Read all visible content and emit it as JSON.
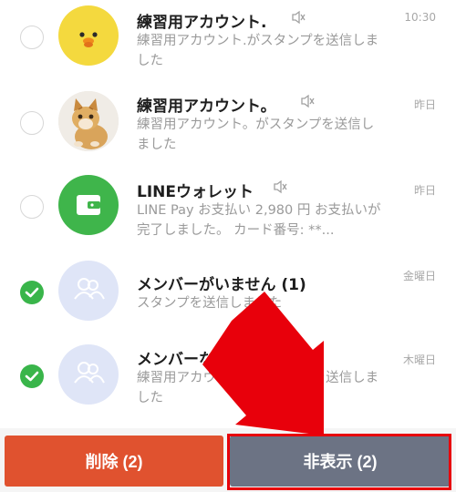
{
  "chats": [
    {
      "name": "練習用アカウント.",
      "preview": "練習用アカウント.がスタンプを送信しました",
      "time": "10:30",
      "checked": false,
      "avatar_icon": "yellow-chick-sticker-icon"
    },
    {
      "name": "練習用アカウント。",
      "preview": "練習用アカウント。がスタンプを送信しました",
      "time": "昨日",
      "checked": false,
      "avatar_icon": "kitten-photo"
    },
    {
      "name": "LINEウォレット",
      "preview": "LINE Pay お支払い 2,980 円 お支払いが完了しました。 カード番号: **...",
      "time": "昨日",
      "checked": false,
      "avatar_icon": "wallet-icon"
    },
    {
      "name": "メンバーがいません (1)",
      "preview": "スタンプを送信しました",
      "time": "金曜日",
      "checked": true,
      "avatar_icon": "group-people-icon"
    },
    {
      "name": "メンバーなし",
      "preview": "練習用アカウント.がスタンプを送信しました",
      "time": "木曜日",
      "checked": true,
      "avatar_icon": "group-people-icon"
    }
  ],
  "actions": {
    "delete_label": "削除 (2)",
    "hide_label": "非表示 (2)"
  },
  "colors": {
    "check_on": "#39b54a",
    "delete": "#e0522f",
    "hide": "#6c7384",
    "highlight": "#e8000b",
    "wallet_green": "#3fb54b",
    "group_avatar_bg": "#dfe5f7"
  },
  "icons": {
    "mute": "speaker-muted-icon",
    "check": "checkmark-icon",
    "annotation": "red-arrow"
  }
}
